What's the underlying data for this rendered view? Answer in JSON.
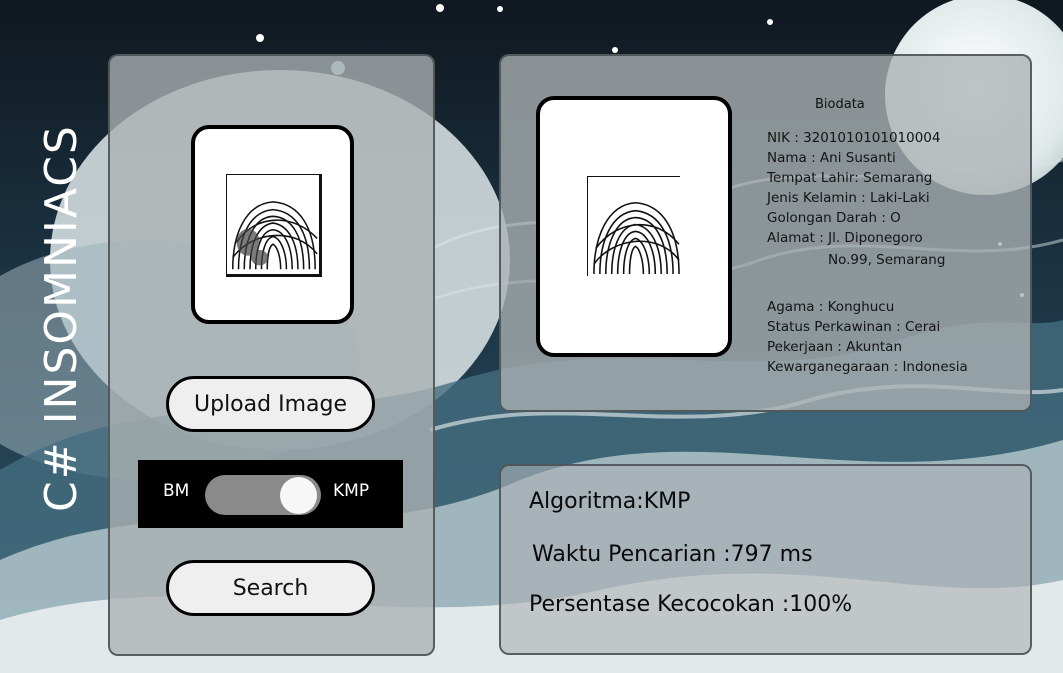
{
  "brand": {
    "title": "C# INSOMNIACS"
  },
  "upload": {
    "button_label": "Upload Image"
  },
  "algorithm_toggle": {
    "left_label": "BM",
    "right_label": "KMP",
    "selected": "KMP"
  },
  "search": {
    "button_label": "Search"
  },
  "biodata": {
    "title": "Biodata",
    "nik": "NIK : 3201010101010004",
    "nama": "Nama : Ani Susanti",
    "tempat_lahir": "Tempat Lahir: Semarang",
    "jenis_kelamin": "Jenis Kelamin : Laki-Laki",
    "golongan_darah": "Golongan Darah : O",
    "alamat_line1": "Alamat : Jl. Diponegoro",
    "alamat_line2": "No.99, Semarang",
    "agama": "Agama : Konghucu",
    "status_perkawinan": "Status Perkawinan : Cerai",
    "pekerjaan": "Pekerjaan : Akuntan",
    "kewarganegaraan": "Kewarganegaraan : Indonesia"
  },
  "result": {
    "algoritma_label": "Algoritma: ",
    "algoritma_value": "KMP",
    "waktu_label": "Waktu Pencarian : ",
    "waktu_value": "797 ms",
    "persentase_label": "Persentase Kecocokan : ",
    "persentase_value": "100%"
  },
  "colors": {
    "panel_bg": "#acb2b4",
    "button_bg": "#efefef",
    "toggle_bg": "#000000",
    "switch_track": "#8a8a8a"
  },
  "icons": {
    "query_fingerprint": "fingerprint-icon",
    "matched_fingerprint": "fingerprint-icon"
  }
}
